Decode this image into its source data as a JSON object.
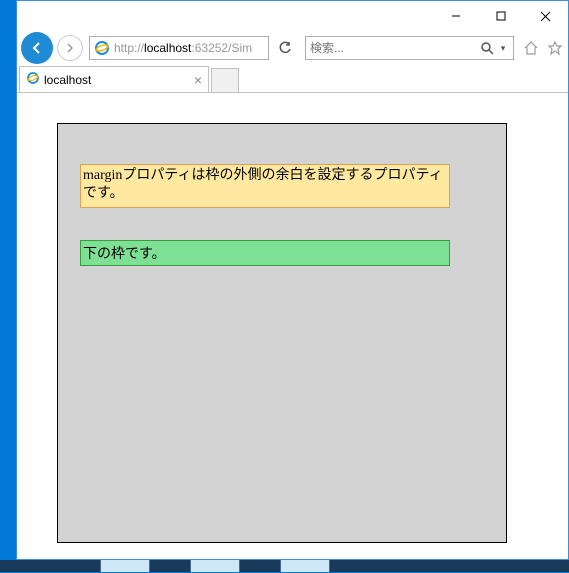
{
  "titlebar": {
    "minimize": "minimize",
    "maximize": "maximize",
    "close": "close"
  },
  "nav": {
    "back": "back",
    "forward": "forward",
    "refresh": "refresh"
  },
  "address": {
    "prefix": "http://",
    "host": "localhost",
    "port_path": ":63252/Sim"
  },
  "search": {
    "placeholder": "検索...",
    "submit": "search",
    "dropdown": "options"
  },
  "tools": {
    "home": "home",
    "favorites": "favorites"
  },
  "tab": {
    "title": "localhost",
    "close": "close-tab",
    "new": "new-tab"
  },
  "page": {
    "box1_text": "marginプロパティは枠の外側の余白を設定するプロパティです。",
    "box2_text": "下の枠です。"
  }
}
